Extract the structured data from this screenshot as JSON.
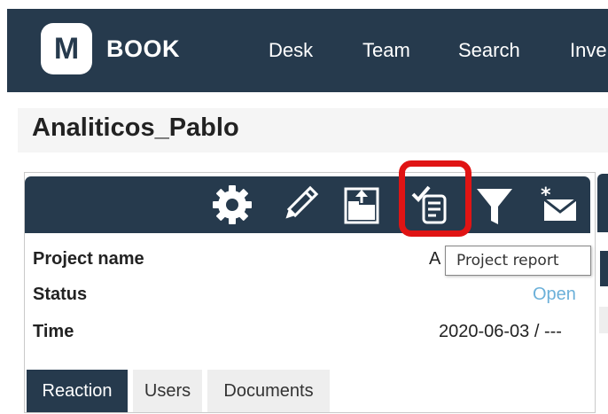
{
  "app": {
    "logo_letter": "M",
    "brand": "BOOK"
  },
  "nav": {
    "items": [
      "Desk",
      "Team",
      "Search",
      "Inve"
    ]
  },
  "page": {
    "title": "Analiticos_Pablo"
  },
  "toolbar": {
    "icons": [
      "gear-icon",
      "pencil-icon",
      "upload-folder-icon",
      "project-report-icon",
      "filter-icon",
      "mail-icon"
    ],
    "highlighted": "project-report-icon"
  },
  "tooltip": {
    "text": "Project report"
  },
  "fields": {
    "project_name_label": "Project name",
    "project_name_value": "A",
    "status_label": "Status",
    "status_value": "Open",
    "time_label": "Time",
    "time_value": "2020-06-03 / ---"
  },
  "tabs": [
    "Reaction",
    "Users",
    "Documents"
  ],
  "active_tab": "Reaction",
  "colors": {
    "navbar": "#263a4d",
    "highlight": "#e01414",
    "status_open": "#6bb0d9"
  }
}
